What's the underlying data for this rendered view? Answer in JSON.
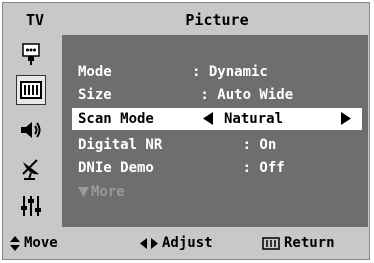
{
  "header": {
    "source_label": "TV",
    "menu_title": "Picture"
  },
  "sidebar": {
    "icons": [
      {
        "name": "input-icon"
      },
      {
        "name": "picture-icon",
        "selected": true
      },
      {
        "name": "sound-icon"
      },
      {
        "name": "channel-icon"
      },
      {
        "name": "setup-icon"
      }
    ]
  },
  "menu": {
    "items": [
      {
        "label": "Mode",
        "value": ": Dynamic"
      },
      {
        "label": "Size",
        "value": " : Auto Wide"
      },
      {
        "label": "Scan Mode",
        "value": "Natural",
        "highlighted": true
      },
      {
        "label": "Digital NR",
        "value": "      : On"
      },
      {
        "label": "DNIe Demo",
        "value": "      : Off"
      }
    ],
    "more_label": "More"
  },
  "footer": {
    "move_label": "Move",
    "adjust_label": "Adjust",
    "return_label": "Return"
  },
  "colors": {
    "frame_bg": "#c8c8c8",
    "panel_bg": "#6e6e6e",
    "highlight_bg": "#ffffff",
    "text_on_panel": "#ffffff",
    "disabled_text": "#9a9a9a"
  }
}
